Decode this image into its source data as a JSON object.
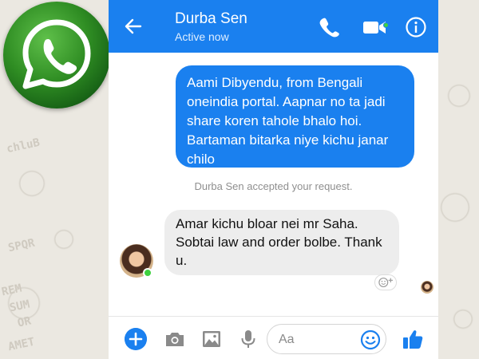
{
  "header": {
    "contact_name": "Durba Sen",
    "status": "Active now",
    "icons": [
      "back-arrow-icon",
      "phone-icon",
      "video-camera-icon",
      "info-icon"
    ]
  },
  "messages": [
    {
      "direction": "outgoing",
      "text": "Aami Dibyendu, from Bengali oneindia portal. Aapnar no ta jadi share koren tahole bhalo hoi. Bartaman bitarka niye kichu janar chilo"
    },
    {
      "direction": "system",
      "text": "Durba Sen accepted your request."
    },
    {
      "direction": "incoming",
      "text": "Amar kichu bloar nei mr Saha. Sobtai law and order bolbe. Thank u."
    }
  ],
  "composer": {
    "placeholder": "Aa",
    "icons": [
      "plus-icon",
      "camera-icon",
      "image-icon",
      "microphone-icon",
      "emoji-icon",
      "thumbs-up-icon"
    ]
  },
  "wallpaper": {
    "doodles": [
      "chluB",
      "SPQR",
      "REM",
      "SUM",
      "OR",
      "AMET"
    ]
  },
  "colors": {
    "accent": "#1a80ef",
    "incoming_bubble": "#ededed",
    "online": "#3fd13f",
    "whatsapp_green": "#2f8d23"
  }
}
